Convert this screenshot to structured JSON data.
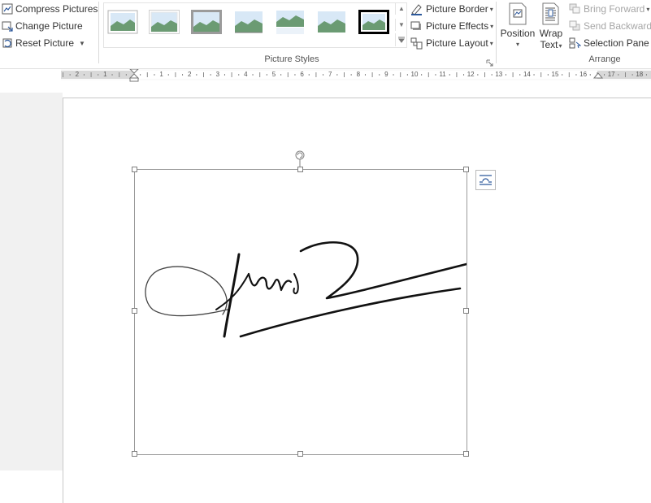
{
  "adjust": {
    "compress_label": "Compress Pictures",
    "change_label": "Change Picture",
    "reset_label": "Reset Picture"
  },
  "picture_styles": {
    "group_label": "Picture Styles",
    "gallery": [
      "style-1",
      "style-2",
      "style-3",
      "style-4",
      "style-5",
      "style-6",
      "style-7"
    ],
    "border_label": "Picture Border",
    "effects_label": "Picture Effects",
    "layout_label": "Picture Layout"
  },
  "arrange": {
    "group_label": "Arrange",
    "position_label": "Position",
    "wrap_label_1": "Wrap",
    "wrap_label_2": "Text",
    "bring_forward_label": "Bring Forward",
    "send_backward_label": "Send Backward",
    "selection_pane_label": "Selection Pane"
  },
  "ruler": {
    "labels": [
      "2",
      "1",
      "1",
      "2",
      "3",
      "4",
      "5",
      "6",
      "7",
      "8",
      "9",
      "10",
      "11",
      "12",
      "13",
      "14",
      "15",
      "16",
      "17",
      "18"
    ]
  },
  "colors": {
    "accent": "#2b579a",
    "group_label": "#555555",
    "disabled": "#a6a6a6"
  },
  "icons": [
    "compress-icon",
    "change-picture-icon",
    "reset-picture-icon",
    "picture-border-icon",
    "picture-effects-icon",
    "picture-layout-icon",
    "position-icon",
    "wrap-text-icon",
    "bring-forward-icon",
    "send-backward-icon",
    "selection-pane-icon",
    "rotate-handle-icon",
    "layout-options-icon"
  ]
}
